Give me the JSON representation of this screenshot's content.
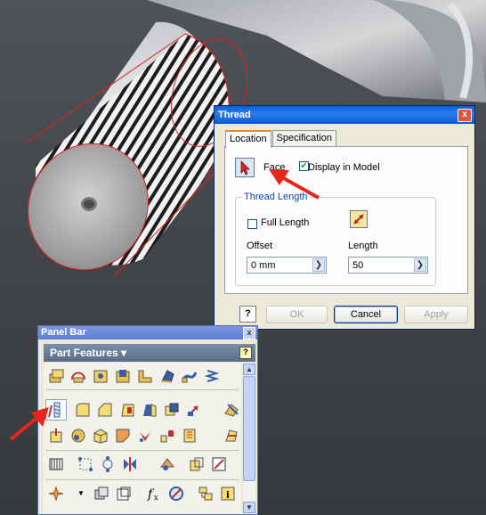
{
  "dialog": {
    "title": "Thread",
    "close_label": "x",
    "tabs": [
      {
        "label": "Location"
      },
      {
        "label": "Specification"
      }
    ],
    "face_label": "Face",
    "display_in_model_label": "Display in Model",
    "display_in_model_checked": true,
    "thread_length_group": "Thread Length",
    "full_length_label": "Full Length",
    "full_length_checked": false,
    "offset_label": "Offset",
    "offset_value": "0 mm",
    "length_label": "Length",
    "length_value": "50",
    "help_label": "?",
    "ok_label": "OK",
    "cancel_label": "Cancel",
    "apply_label": "Apply"
  },
  "panel_bar": {
    "title": "Panel Bar",
    "close_label": "x",
    "header": "Part Features",
    "help_label": "?",
    "selected_tool": "thread-tool-icon"
  },
  "colors": {
    "arrow": "#e8241c",
    "title_bar": "#0a5fd8",
    "tab_accent": "#e68b2c"
  }
}
